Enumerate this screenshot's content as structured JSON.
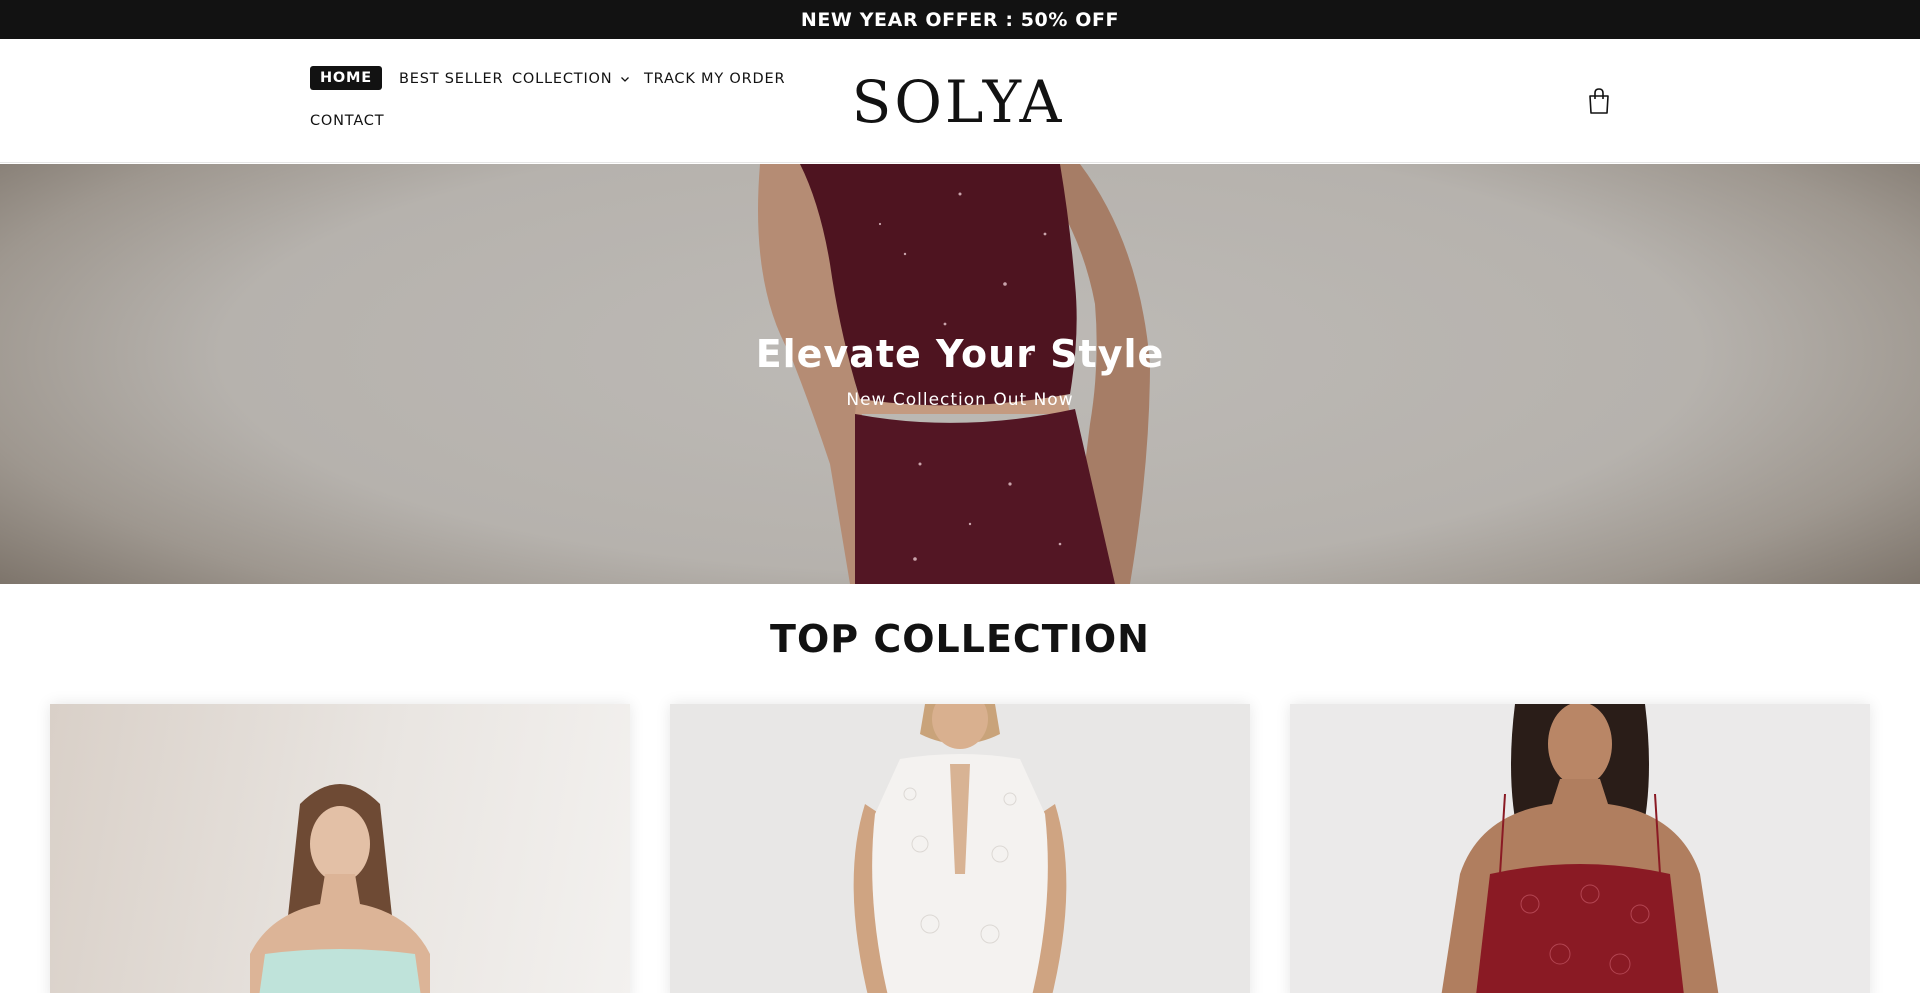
{
  "announcement": {
    "text": "NEW YEAR OFFER : 50% OFF"
  },
  "header": {
    "nav": [
      {
        "label": "HOME",
        "active": true
      },
      {
        "label": "BEST SELLER"
      },
      {
        "label": "COLLECTION",
        "has_dropdown": true,
        "icon": "chevron-down-icon"
      },
      {
        "label": "TRACK MY ORDER"
      },
      {
        "label": "CONTACT"
      }
    ],
    "logo": "SOLYA",
    "cart_icon": "shopping-bag-icon"
  },
  "hero": {
    "title": "Elevate Your Style",
    "subtitle": "New Collection Out Now"
  },
  "top_collection": {
    "title": "TOP COLLECTION",
    "cards": [
      {
        "description_color": "#bfe3da"
      },
      {
        "description_color": "#f4f2f0"
      },
      {
        "description_color": "#8a1a24"
      }
    ]
  },
  "colors": {
    "announcement_bg": "#121212",
    "active_nav_bg": "#121212",
    "text": "#121212",
    "hero_outfit": "#4e1420"
  }
}
